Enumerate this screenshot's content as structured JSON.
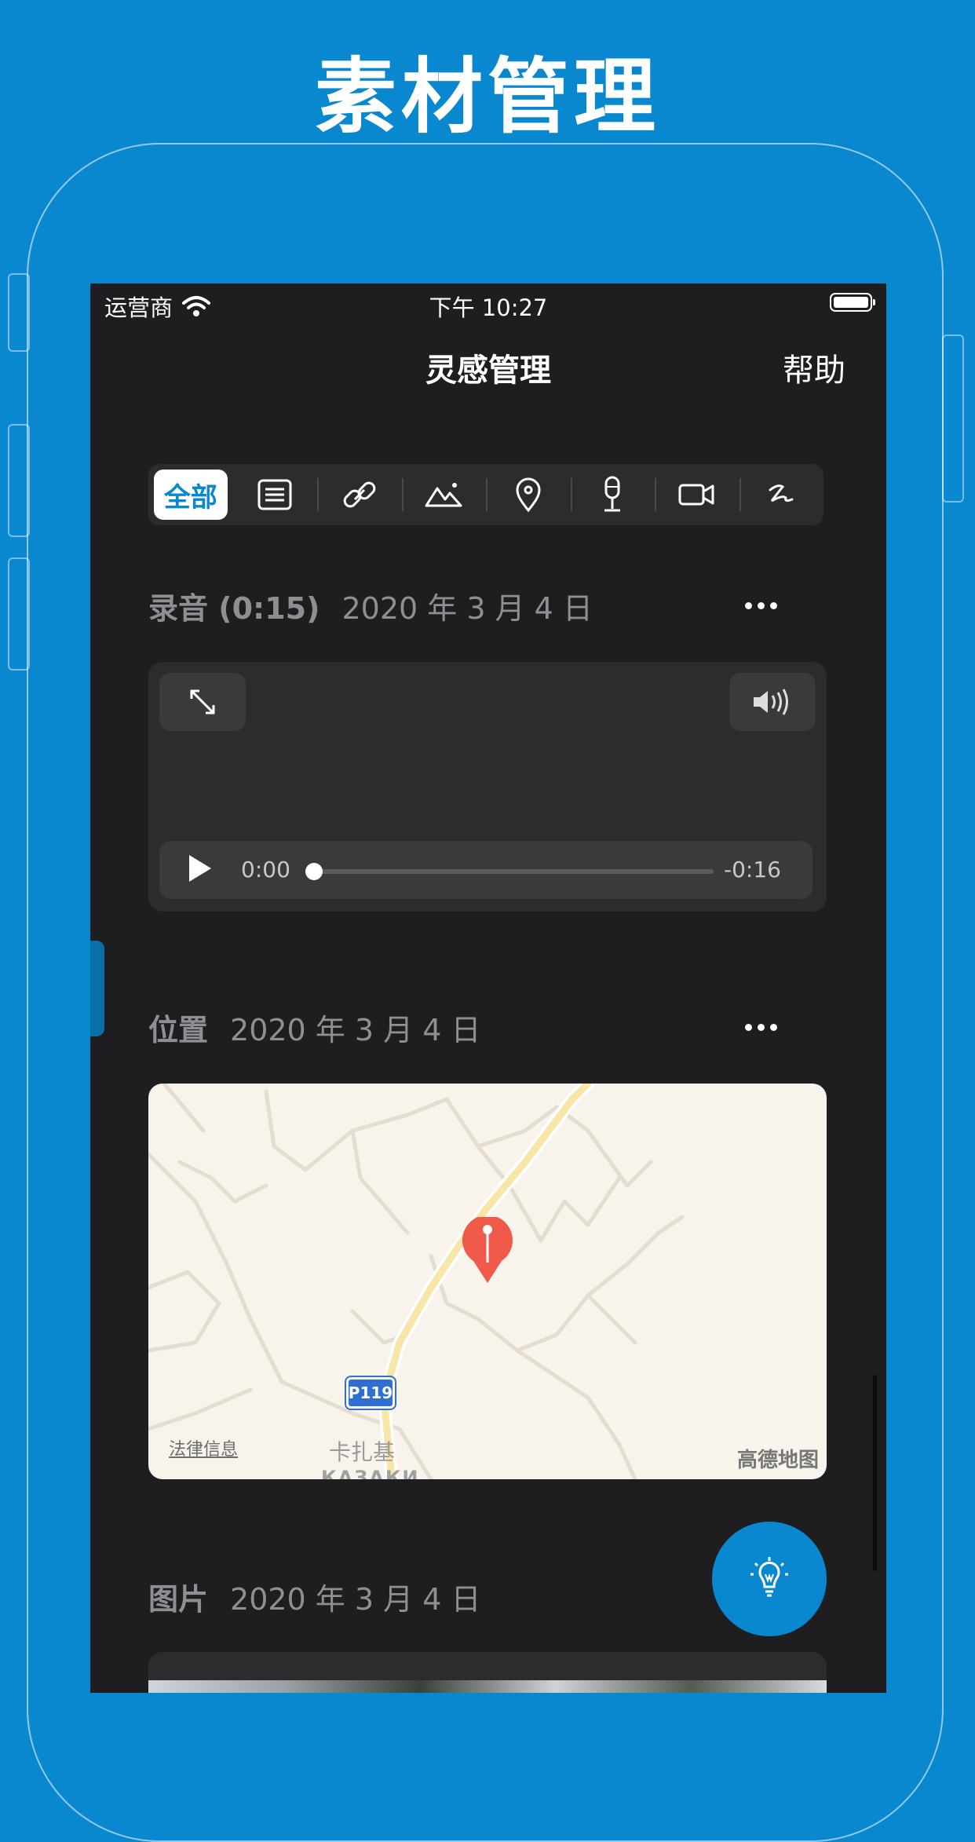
{
  "promo": {
    "title": "素材管理"
  },
  "status_bar": {
    "carrier": "运营商",
    "time": "下午 10:27"
  },
  "nav": {
    "title": "灵感管理",
    "help": "帮助"
  },
  "filter": {
    "active": "全部",
    "icons": [
      "text-icon",
      "link-icon",
      "image-icon",
      "location-pin-icon",
      "microphone-icon",
      "video-camera-icon",
      "scribble-icon"
    ]
  },
  "audio_section": {
    "kind": "录音 (0:15)",
    "date": "2020 年 3 月 4 日",
    "elapsed": "0:00",
    "remaining": "-0:16",
    "progress": 0.0
  },
  "location_section": {
    "kind": "位置",
    "date": "2020 年 3 月 4 日",
    "map": {
      "legal": "法律信息",
      "provider": "高德地图",
      "road_badge": "P119",
      "place_cn": "卡扎基",
      "place_ru": "КАЗАКИ"
    }
  },
  "image_section": {
    "kind": "图片",
    "date": "2020 年 3 月 4 日"
  },
  "colors": {
    "accent": "#0a88cf",
    "screen_bg": "#1e1e20",
    "card_bg": "#2c2c2e",
    "pin": "#f05a4a"
  }
}
